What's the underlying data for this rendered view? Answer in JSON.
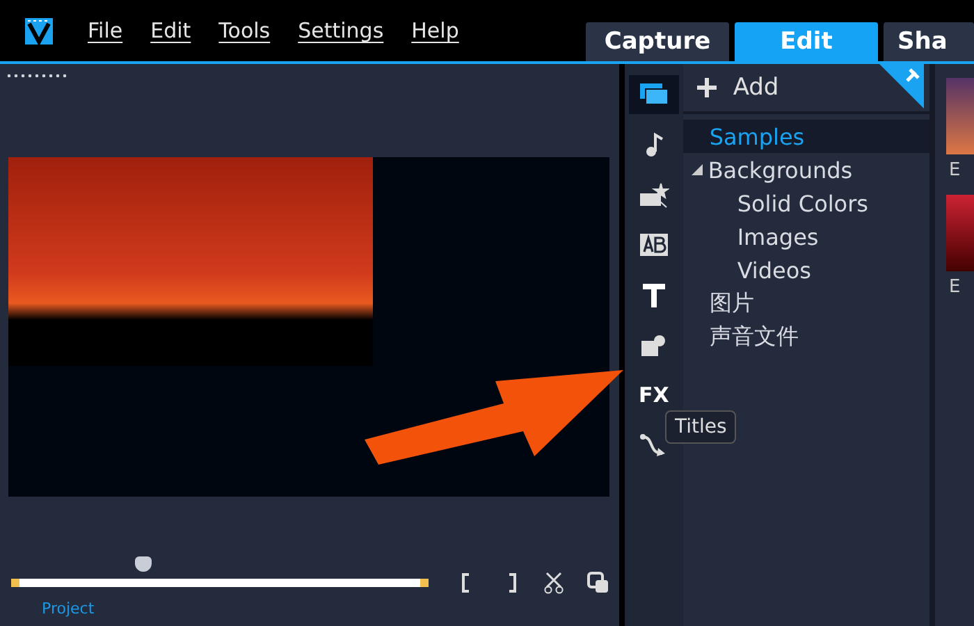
{
  "menu": [
    {
      "label": "File"
    },
    {
      "label": "Edit"
    },
    {
      "label": "Tools"
    },
    {
      "label": "Settings"
    },
    {
      "label": "Help"
    }
  ],
  "tabs": [
    {
      "label": "Capture",
      "selected": false
    },
    {
      "label": "Edit",
      "selected": true
    },
    {
      "label": "Sha",
      "selected": false
    }
  ],
  "scrubber": {
    "level": 0.31
  },
  "project_label": "Project",
  "sidebar_icons": [
    {
      "kind": "media",
      "selected": true
    },
    {
      "kind": "audio",
      "selected": false
    },
    {
      "kind": "transition",
      "selected": false
    },
    {
      "kind": "ab",
      "selected": false
    },
    {
      "kind": "titles",
      "selected": false
    },
    {
      "kind": "graphics",
      "selected": false
    },
    {
      "kind": "fx",
      "label": "FX",
      "selected": false
    },
    {
      "kind": "path",
      "selected": false
    }
  ],
  "tooltip": "Titles",
  "library": {
    "add_label": "Add",
    "items": [
      {
        "label": "Samples",
        "selected": true
      },
      {
        "label": "Backgrounds",
        "expanded": true,
        "selected": false,
        "children": [
          {
            "label": "Solid Colors",
            "selected": false
          },
          {
            "label": "Images",
            "selected": false
          },
          {
            "label": "Videos",
            "selected": false
          }
        ]
      },
      {
        "label": "图片",
        "selected": false
      },
      {
        "label": "声音文件",
        "selected": false
      }
    ]
  },
  "thumbnails": [
    {
      "label": "E"
    },
    {
      "label": "E"
    }
  ]
}
